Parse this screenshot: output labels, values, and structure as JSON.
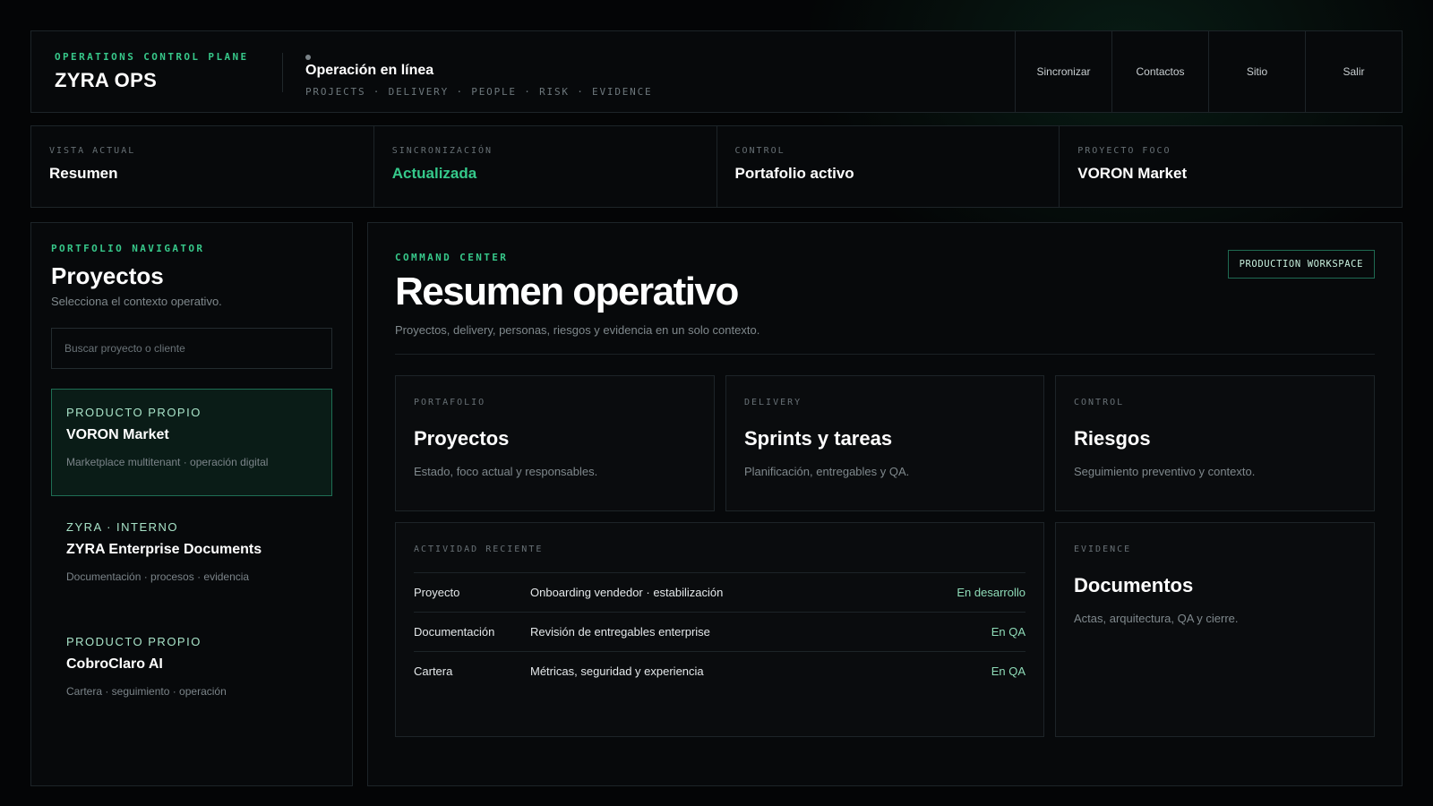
{
  "header": {
    "eyebrow": "OPERATIONS CONTROL PLANE",
    "app_name": "ZYRA OPS",
    "status_title": "Operación en línea",
    "modules": "PROJECTS · DELIVERY · PEOPLE · RISK · EVIDENCE",
    "actions": [
      "Sincronizar",
      "Contactos",
      "Sitio",
      "Salir"
    ]
  },
  "strip": [
    {
      "label": "VISTA ACTUAL",
      "value": "Resumen"
    },
    {
      "label": "SINCRONIZACIÓN",
      "value": "Actualizada"
    },
    {
      "label": "CONTROL",
      "value": "Portafolio activo"
    },
    {
      "label": "PROYECTO FOCO",
      "value": "VORON Market"
    }
  ],
  "colors": {
    "accent": "#37c88a",
    "active_bg": "#0a1c17",
    "active_border": "#1e6e54"
  },
  "sidebar": {
    "eyebrow": "PORTFOLIO NAVIGATOR",
    "title": "Proyectos",
    "subtitle": "Selecciona el contexto operativo.",
    "search_placeholder": "Buscar proyecto o cliente",
    "projects": [
      {
        "tag": "PRODUCTO PROPIO",
        "name": "VORON Market",
        "desc": "Marketplace multitenant · operación digital",
        "active": true
      },
      {
        "tag": "ZYRA · INTERNO",
        "name": "ZYRA Enterprise Documents",
        "desc": "Documentación · procesos · evidencia",
        "active": false
      },
      {
        "tag": "PRODUCTO PROPIO",
        "name": "CobroClaro AI",
        "desc": "Cartera · seguimiento · operación",
        "active": false
      }
    ]
  },
  "main": {
    "eyebrow": "COMMAND CENTER",
    "title": "Resumen operativo",
    "subtitle": "Proyectos, delivery, personas, riesgos y evidencia en un solo contexto.",
    "badge": "PRODUCTION WORKSPACE",
    "cards": [
      {
        "label": "PORTAFOLIO",
        "title": "Proyectos",
        "desc": "Estado, foco actual y responsables."
      },
      {
        "label": "DELIVERY",
        "title": "Sprints y tareas",
        "desc": "Planificación, entregables y QA."
      },
      {
        "label": "CONTROL",
        "title": "Riesgos",
        "desc": "Seguimiento preventivo y contexto."
      }
    ],
    "activity": {
      "label": "ACTIVIDAD RECIENTE",
      "rows": [
        {
          "type": "Proyecto",
          "desc": "Onboarding vendedor · estabilización",
          "status": "En desarrollo"
        },
        {
          "type": "Documentación",
          "desc": "Revisión de entregables enterprise",
          "status": "En QA"
        },
        {
          "type": "Cartera",
          "desc": "Métricas, seguridad y experiencia",
          "status": "En QA"
        }
      ]
    },
    "evidence": {
      "label": "EVIDENCE",
      "title": "Documentos",
      "desc": "Actas, arquitectura, QA y cierre."
    }
  }
}
